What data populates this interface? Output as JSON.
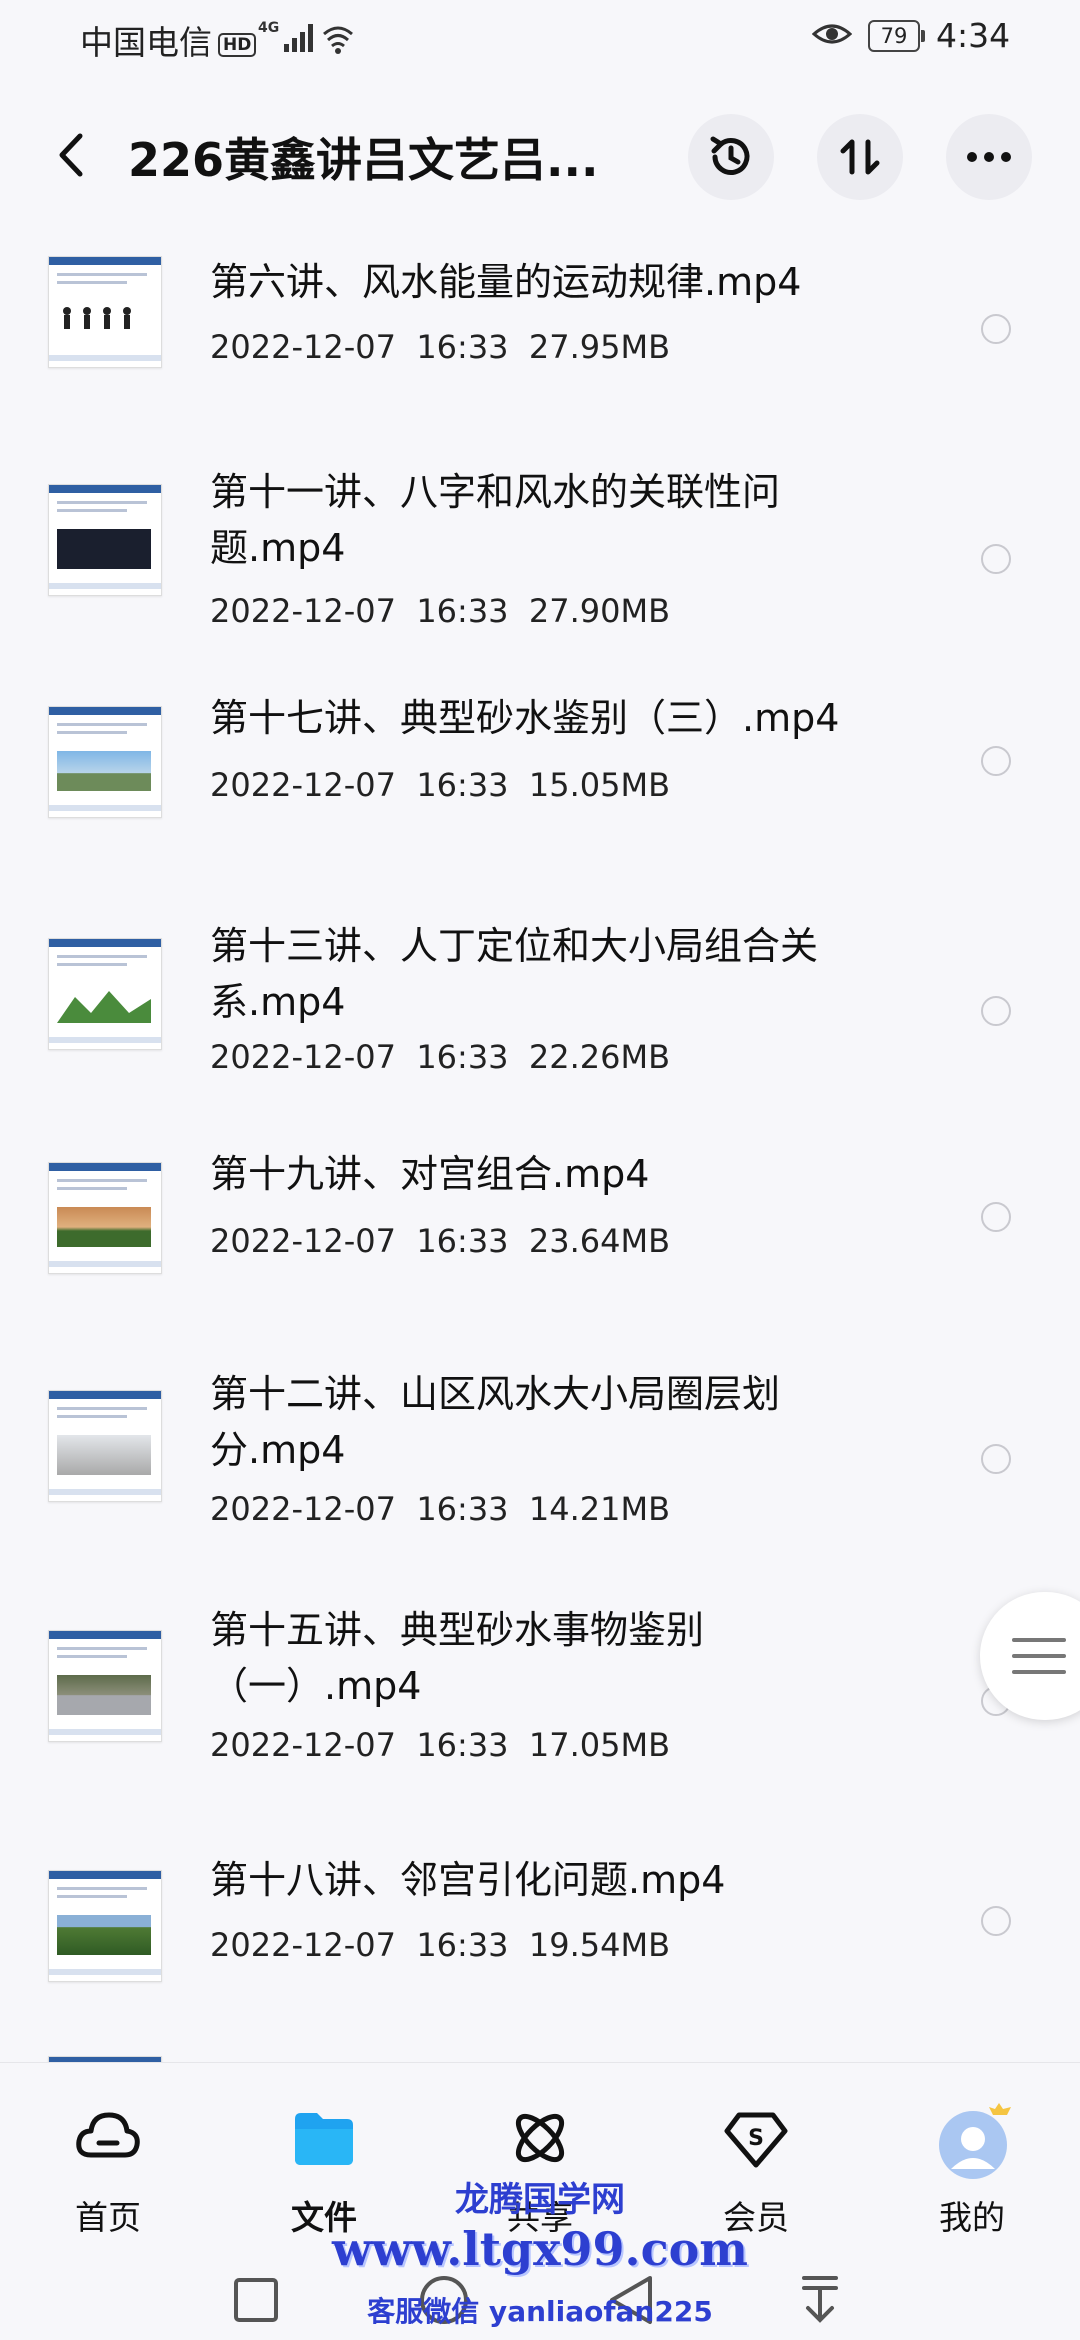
{
  "status_bar": {
    "carrier": "中国电信",
    "hd": "HD",
    "network": "4G",
    "battery": "79",
    "time": "4:34"
  },
  "header": {
    "title": "226黄鑫讲吕文艺吕..."
  },
  "files": [
    {
      "name": "第六讲、风水能量的运动规律.mp4",
      "meta": "2022-12-07  16:33  27.95MB"
    },
    {
      "name": "第十一讲、八字和风水的关联性问题.mp4",
      "meta": "2022-12-07  16:33  27.90MB"
    },
    {
      "name": "第十七讲、典型砂水鉴别（三）.mp4",
      "meta": "2022-12-07  16:33  15.05MB"
    },
    {
      "name": "第十三讲、人丁定位和大小局组合关系.mp4",
      "meta": "2022-12-07  16:33  22.26MB"
    },
    {
      "name": "第十九讲、对宫组合.mp4",
      "meta": "2022-12-07  16:33  23.64MB"
    },
    {
      "name": "第十二讲、山区风水大小局圈层划分.mp4",
      "meta": "2022-12-07  16:33  14.21MB"
    },
    {
      "name": "第十五讲、典型砂水事物鉴别（一）.mp4",
      "meta": "2022-12-07  16:33  17.05MB"
    },
    {
      "name": "第十八讲、邻宫引化问题.mp4",
      "meta": "2022-12-07  16:33  19.54MB"
    }
  ],
  "nav": {
    "home": "首页",
    "files": "文件",
    "share": "共享",
    "vip": "会员",
    "mine": "我的"
  },
  "watermark": {
    "line1": "龙腾国学网",
    "line2": "www.ltgx99.com",
    "line3": "客服微信 yanliaofan225"
  },
  "colors": {
    "accent": "#1fa3f0",
    "watermark": "#2d3fd0"
  }
}
